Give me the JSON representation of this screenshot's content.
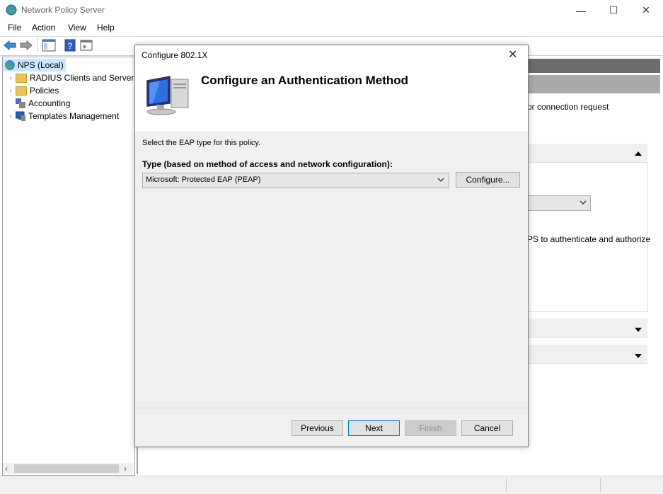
{
  "app": {
    "title": "Network Policy Server",
    "caption_min": "—",
    "caption_max": "☐",
    "caption_close": "✕"
  },
  "menu": [
    "File",
    "Action",
    "View",
    "Help"
  ],
  "tree": {
    "root": "NPS (Local)",
    "items": [
      {
        "label": "RADIUS Clients and Servers",
        "expander": "›",
        "icon": "folder-icon"
      },
      {
        "label": "Policies",
        "expander": "›",
        "icon": "folder-icon"
      },
      {
        "label": "Accounting",
        "expander": "",
        "icon": "accounting-icon"
      },
      {
        "label": "Templates Management",
        "expander": "›",
        "icon": "templates-icon"
      }
    ]
  },
  "scroll": {
    "left": "‹",
    "right": "›"
  },
  "background": {
    "text1": "or connection request",
    "text2": "PS to authenticate and authorize"
  },
  "dialog": {
    "title": "Configure 802.1X",
    "close": "✕",
    "heading": "Configure an Authentication Method",
    "instruction": "Select the EAP type for this policy.",
    "type_label": "Type (based on method of access and network configuration):",
    "type_value": "Microsoft: Protected EAP (PEAP)",
    "configure_label": "Configure...",
    "previous_label": "Previous",
    "next_label": "Next",
    "finish_label": "Finish",
    "cancel_label": "Cancel"
  },
  "colors": {
    "dialog_bg": "#f0f0f0",
    "accent": "#0078d7",
    "header_gray": "#6d6d6d"
  }
}
